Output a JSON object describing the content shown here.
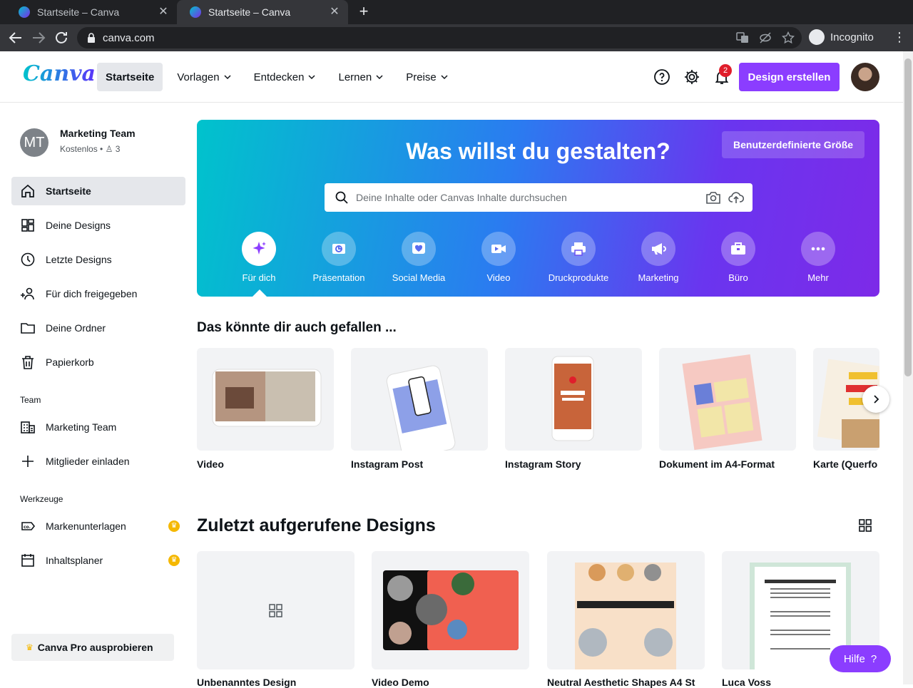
{
  "browser": {
    "tabs": [
      {
        "title": "Startseite – Canva"
      },
      {
        "title": "Startseite – Canva"
      }
    ],
    "url": "canva.com",
    "profile": "Incognito"
  },
  "header": {
    "logo": "Canva",
    "nav": [
      {
        "label": "Startseite"
      },
      {
        "label": "Vorlagen"
      },
      {
        "label": "Entdecken"
      },
      {
        "label": "Lernen"
      },
      {
        "label": "Preise"
      }
    ],
    "notifications_count": "2",
    "create_button": "Design erstellen"
  },
  "sidebar": {
    "team_initials": "MT",
    "team_name": "Marketing Team",
    "plan": "Kostenlos • ",
    "members": "3",
    "items": [
      {
        "label": "Startseite"
      },
      {
        "label": "Deine Designs"
      },
      {
        "label": "Letzte Designs"
      },
      {
        "label": "Für dich freigegeben"
      },
      {
        "label": "Deine Ordner"
      },
      {
        "label": "Papierkorb"
      }
    ],
    "team_section": "Team",
    "team_items": [
      {
        "label": "Marketing Team"
      },
      {
        "label": "Mitglieder einladen"
      }
    ],
    "tools_section": "Werkzeuge",
    "tools_items": [
      {
        "label": "Markenunterlagen"
      },
      {
        "label": "Inhaltsplaner"
      }
    ],
    "pro_button": "Canva Pro ausprobieren"
  },
  "hero": {
    "custom_size": "Benutzerdefinierte Größe",
    "title": "Was willst du gestalten?",
    "search_placeholder": "Deine Inhalte oder Canvas Inhalte durchsuchen",
    "categories": [
      {
        "label": "Für dich",
        "icon": "sparkle-icon"
      },
      {
        "label": "Präsentation",
        "icon": "presentation-icon"
      },
      {
        "label": "Social Media",
        "icon": "heart-icon"
      },
      {
        "label": "Video",
        "icon": "video-icon"
      },
      {
        "label": "Druckprodukte",
        "icon": "printer-icon"
      },
      {
        "label": "Marketing",
        "icon": "megaphone-icon"
      },
      {
        "label": "Büro",
        "icon": "briefcase-icon"
      },
      {
        "label": "Mehr",
        "icon": "more-icon"
      }
    ]
  },
  "suggestions": {
    "title": "Das könnte dir auch gefallen ...",
    "items": [
      {
        "label": "Video"
      },
      {
        "label": "Instagram Post"
      },
      {
        "label": "Instagram Story"
      },
      {
        "label": "Dokument im A4-Format"
      },
      {
        "label": "Karte (Querfo"
      }
    ]
  },
  "recent": {
    "title": "Zuletzt aufgerufene Designs",
    "items": [
      {
        "label": "Unbenanntes Design"
      },
      {
        "label": "Video Demo"
      },
      {
        "label": "Neutral Aesthetic Shapes A4 St"
      },
      {
        "label": "Luca Voss"
      }
    ]
  },
  "help": "Hilfe",
  "colors": {
    "accent": "#8b3dff",
    "teal": "#00c4cc"
  }
}
